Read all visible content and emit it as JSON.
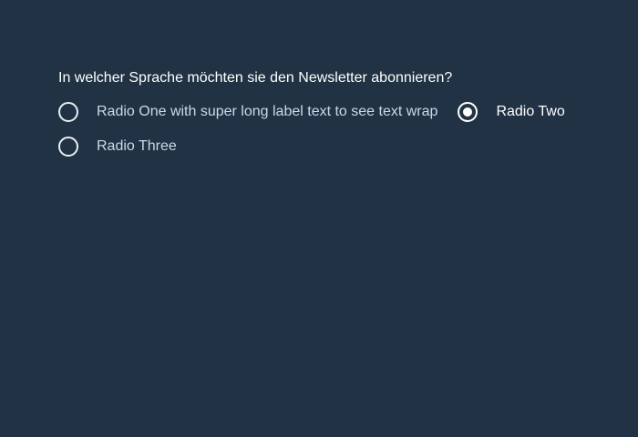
{
  "form": {
    "legend": "In welcher Sprache möchten sie den Newsletter abonnieren?",
    "options": [
      {
        "label": "Radio One with super long label text to see text wrap",
        "checked": false
      },
      {
        "label": "Radio Two",
        "checked": true
      },
      {
        "label": "Radio Three",
        "checked": false
      }
    ]
  },
  "colors": {
    "background": "#203243",
    "label_text": "#c9dbe8",
    "selected_text": "#ffffff",
    "radio_border": "#e9eef3"
  }
}
